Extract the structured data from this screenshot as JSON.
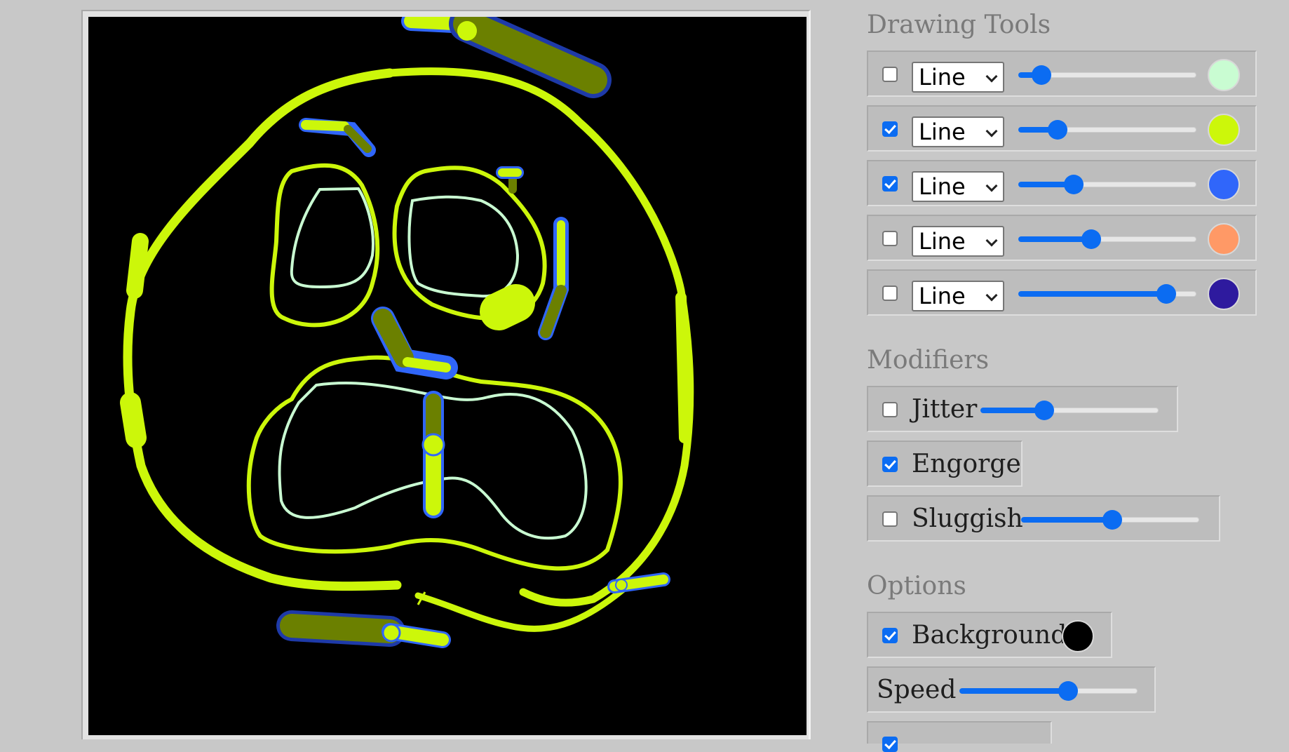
{
  "panel": {
    "drawing_tools_title": "Drawing Tools",
    "modifiers_title": "Modifiers",
    "options_title": "Options"
  },
  "tools": [
    {
      "enabled": false,
      "shape": "Line",
      "size": 0.13,
      "color": "#c9fcd2"
    },
    {
      "enabled": true,
      "shape": "Line",
      "size": 0.22,
      "color": "#ccf70a"
    },
    {
      "enabled": true,
      "shape": "Line",
      "size": 0.31,
      "color": "#3066fa"
    },
    {
      "enabled": false,
      "shape": "Line",
      "size": 0.41,
      "color": "#ff9966"
    },
    {
      "enabled": false,
      "shape": "Line",
      "size": 0.83,
      "color": "#2e1a9e"
    }
  ],
  "modifiers": [
    {
      "label": "Jitter",
      "enabled": false,
      "level": 0.36
    },
    {
      "label": "Engorge",
      "enabled": true
    },
    {
      "label": "Sluggish",
      "enabled": false,
      "level": 0.51
    }
  ],
  "options": {
    "background_label": "Background",
    "background_enabled": true,
    "background_color": "#000000",
    "speed_label": "Speed",
    "speed_level": 0.61,
    "next_option_enabled": true
  },
  "colors": {
    "page_bg": "#c8c8c8",
    "accent": "#0b6cf2",
    "stroke_yellow": "#ccf70a",
    "stroke_mint": "#c9fcd2",
    "stroke_olive": "#6b8000",
    "stroke_blue": "#3066fa"
  }
}
